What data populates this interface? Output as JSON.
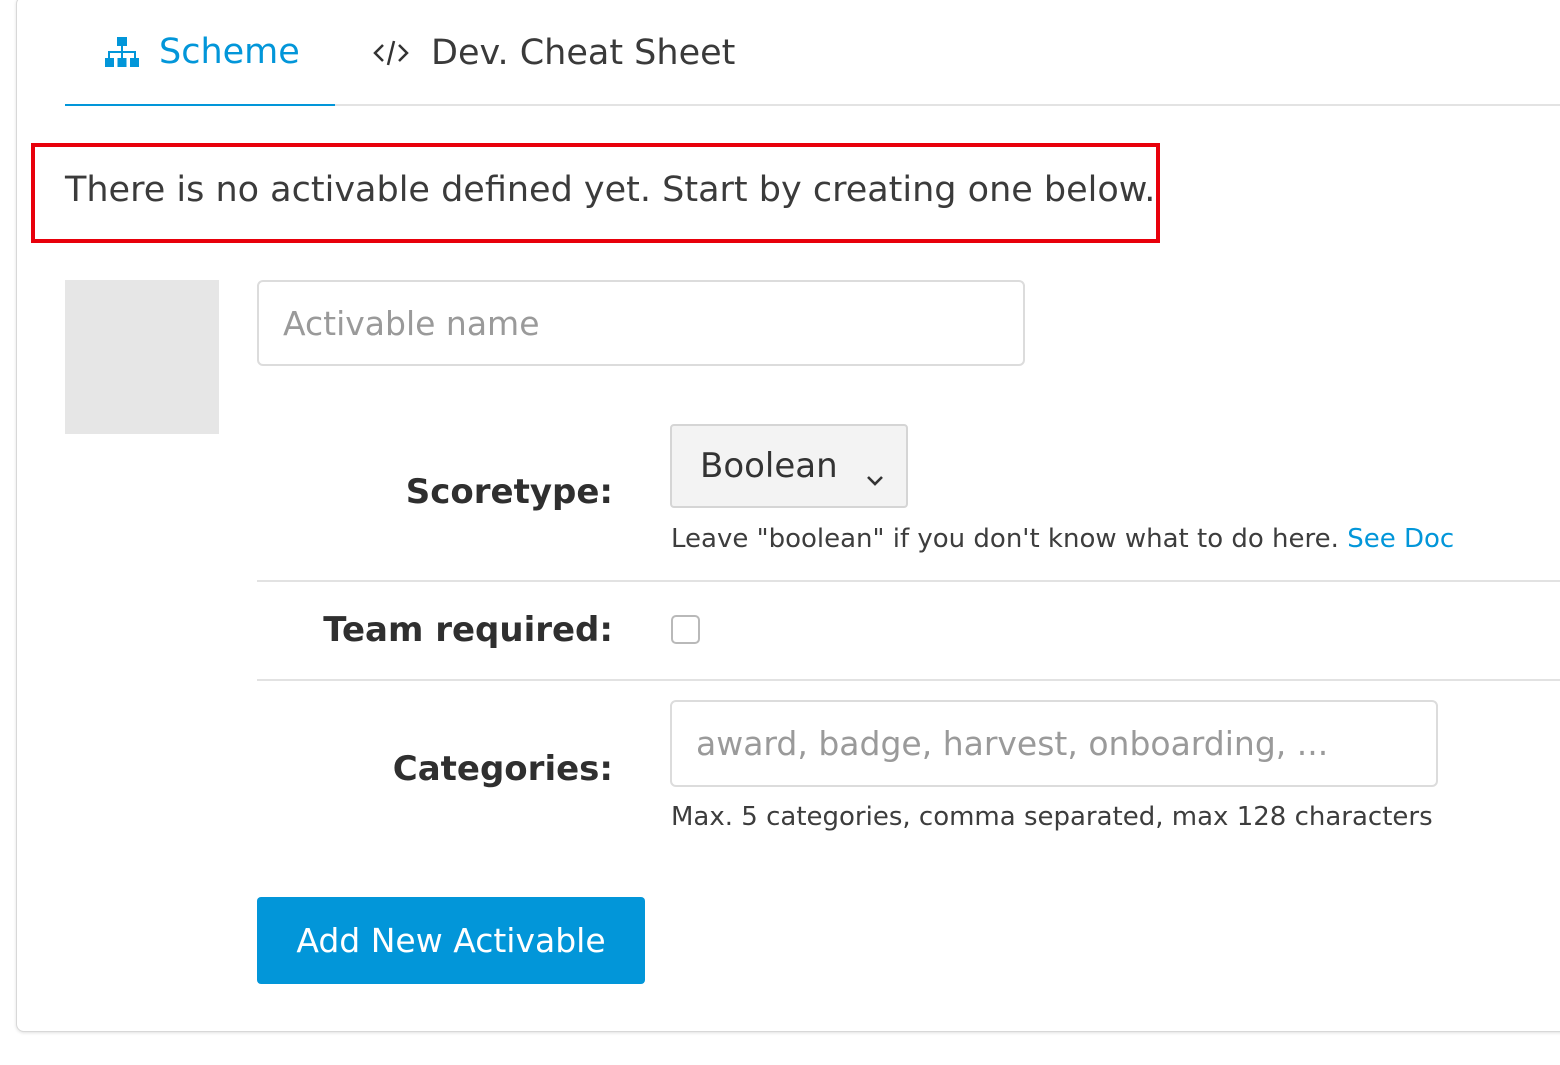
{
  "tabs": {
    "scheme": {
      "label": "Scheme",
      "icon": "sitemap-icon"
    },
    "dev": {
      "label": "Dev. Cheat Sheet",
      "icon": "code-icon"
    }
  },
  "message": "There is no activable defined yet. Start by creating one below.",
  "form": {
    "name_placeholder": "Activable name",
    "scoretype": {
      "label": "Scoretype:",
      "selected": "Boolean",
      "help_text": "Leave \"boolean\" if you don't know what to do here.",
      "help_link": "See Doc"
    },
    "team_required": {
      "label": "Team required:",
      "checked": false
    },
    "categories": {
      "label": "Categories:",
      "placeholder": "award, badge, harvest, onboarding, ...",
      "help_text": "Max. 5 categories, comma separated, max 128 characters"
    },
    "submit_label": "Add New Activable"
  },
  "colors": {
    "accent": "#0296d9",
    "highlight_border": "#e8000b"
  }
}
